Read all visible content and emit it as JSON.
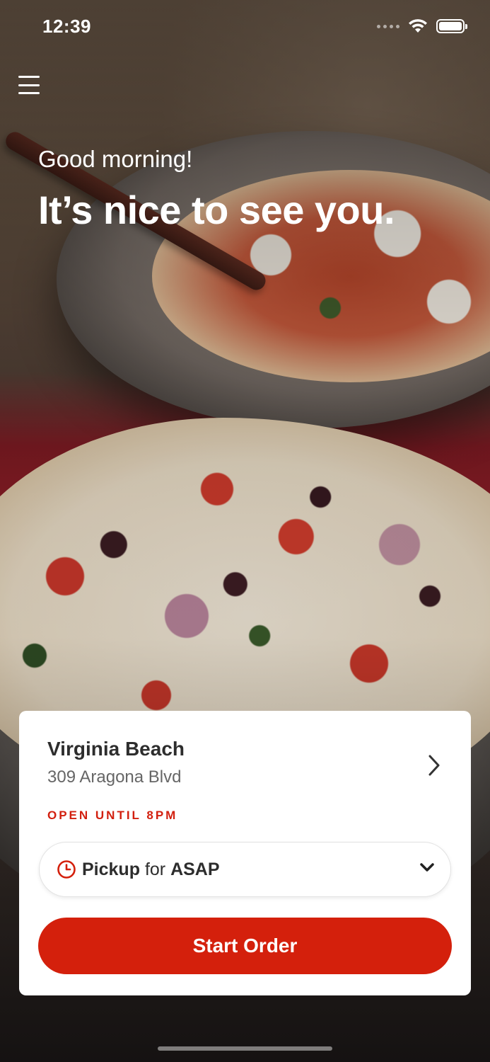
{
  "status_bar": {
    "time": "12:39",
    "icons": [
      "signal-icon",
      "wifi-icon",
      "battery-icon"
    ]
  },
  "header": {
    "menu_icon": "hamburger-menu-icon",
    "greeting": "Good morning!",
    "headline": "It’s nice to see you."
  },
  "background": {
    "description_icon": "pizza-photo"
  },
  "location_card": {
    "name": "Virginia Beach",
    "address": "309 Aragona Blvd",
    "status": "OPEN UNTIL 8PM",
    "status_color": "#d21f0e",
    "pickup": {
      "mode": "Pickup",
      "connector": "for",
      "time": "ASAP",
      "icon": "clock-icon"
    },
    "start_order_label": "Start Order",
    "accent_color": "#d4200c"
  }
}
